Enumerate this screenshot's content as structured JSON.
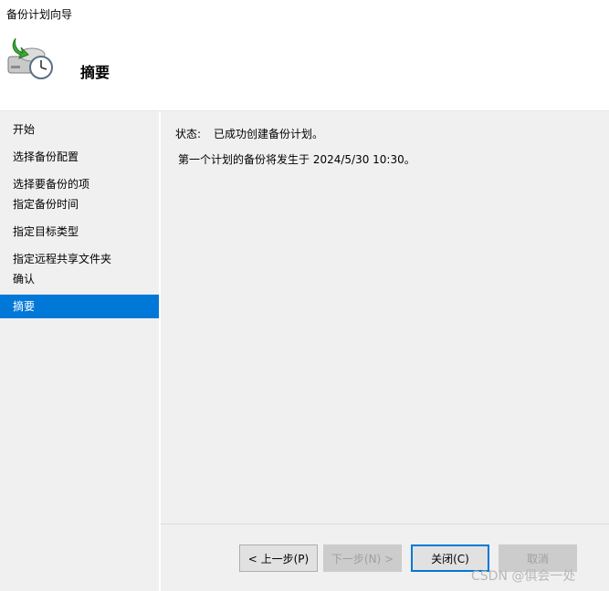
{
  "window": {
    "title": "备份计划向导"
  },
  "header": {
    "heading": "摘要",
    "icon": "backup-clock-icon"
  },
  "nav": {
    "items": [
      {
        "label": "开始",
        "active": false
      },
      {
        "label": "选择备份配置",
        "active": false
      },
      {
        "label": "选择要备份的项",
        "active": false
      },
      {
        "label": "指定备份时间",
        "active": false
      },
      {
        "label": "指定目标类型",
        "active": false
      },
      {
        "label": "指定远程共享文件夹",
        "active": false
      },
      {
        "label": "确认",
        "active": false
      },
      {
        "label": "摘要",
        "active": true
      }
    ]
  },
  "content": {
    "status_label": "状态:",
    "status_value": "已成功创建备份计划。",
    "next_backup": "第一个计划的备份将发生于 2024/5/30 10:30。"
  },
  "buttons": {
    "previous": "< 上一步(P)",
    "next": "下一步(N) >",
    "close": "关闭(C)",
    "cancel": "取消"
  },
  "watermark": "CSDN @俱会一处",
  "colors": {
    "accent": "#0078d7",
    "panel": "#f0f0f0"
  }
}
